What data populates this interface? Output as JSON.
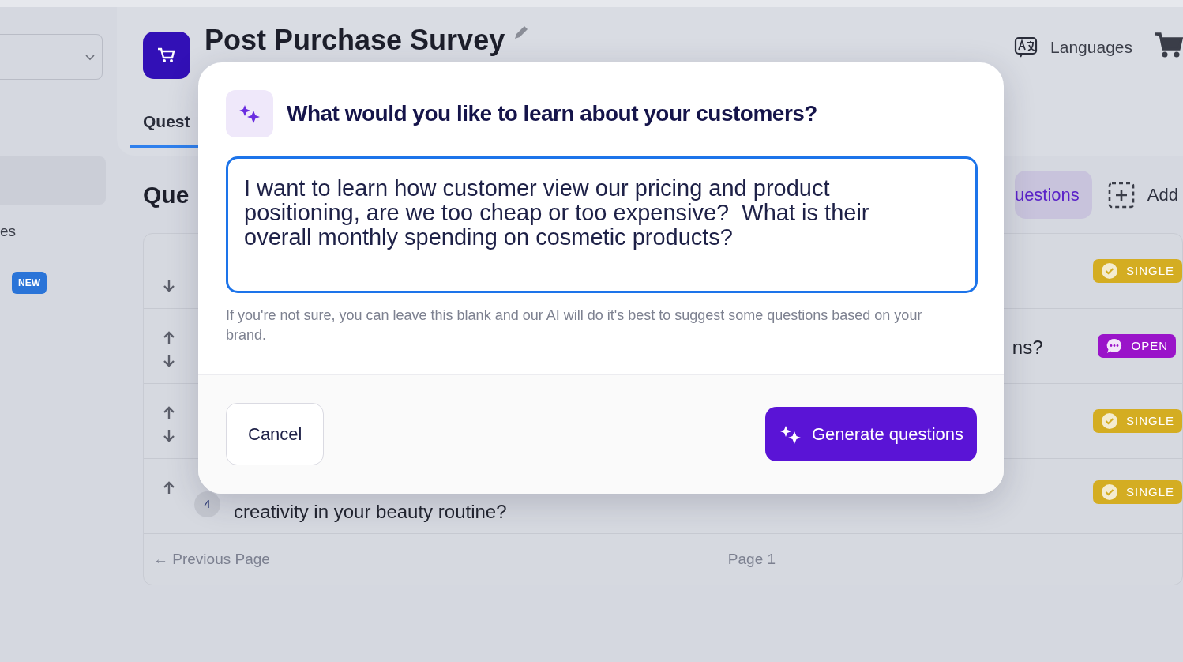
{
  "sidebar": {
    "items": [
      {
        "label": "es"
      }
    ],
    "badge": "NEW"
  },
  "header": {
    "title": "Post Purchase Survey",
    "languages": "Languages"
  },
  "tabs": [
    {
      "label": "Quest",
      "selected": true
    }
  ],
  "section_title": "Que",
  "actions": [
    {
      "label": "uestions",
      "kind": "generate"
    },
    {
      "label": "Add",
      "kind": "add"
    }
  ],
  "questions": [
    {
      "up": false,
      "down": true,
      "type_label": "SINGLE",
      "kind": "single"
    },
    {
      "text": "ns?",
      "up": true,
      "down": true,
      "type_label": "OPEN",
      "kind": "open"
    },
    {
      "up": true,
      "down": true,
      "type_label": "SINGLE",
      "kind": "single"
    },
    {
      "number": "4",
      "text": "creativity in your beauty routine?",
      "up": true,
      "down": false,
      "type_label": "SINGLE",
      "kind": "single"
    }
  ],
  "pagination": {
    "previous": "← Previous Page",
    "page": "Page 1"
  },
  "modal": {
    "title": "What would you like to learn about your customers?",
    "prompt": {
      "value": "I want to learn how customer view our pricing and product positioning, are we too cheap or too expensive?  What is their overall monthly spending on cosmetic products?"
    },
    "help": "If you're not sure, you can leave this blank and our AI will do it's best to suggest some questions based on your brand.",
    "buttons": [
      {
        "label": "Cancel",
        "kind": "secondary"
      },
      {
        "label": "Generate questions",
        "kind": "primary"
      }
    ]
  }
}
